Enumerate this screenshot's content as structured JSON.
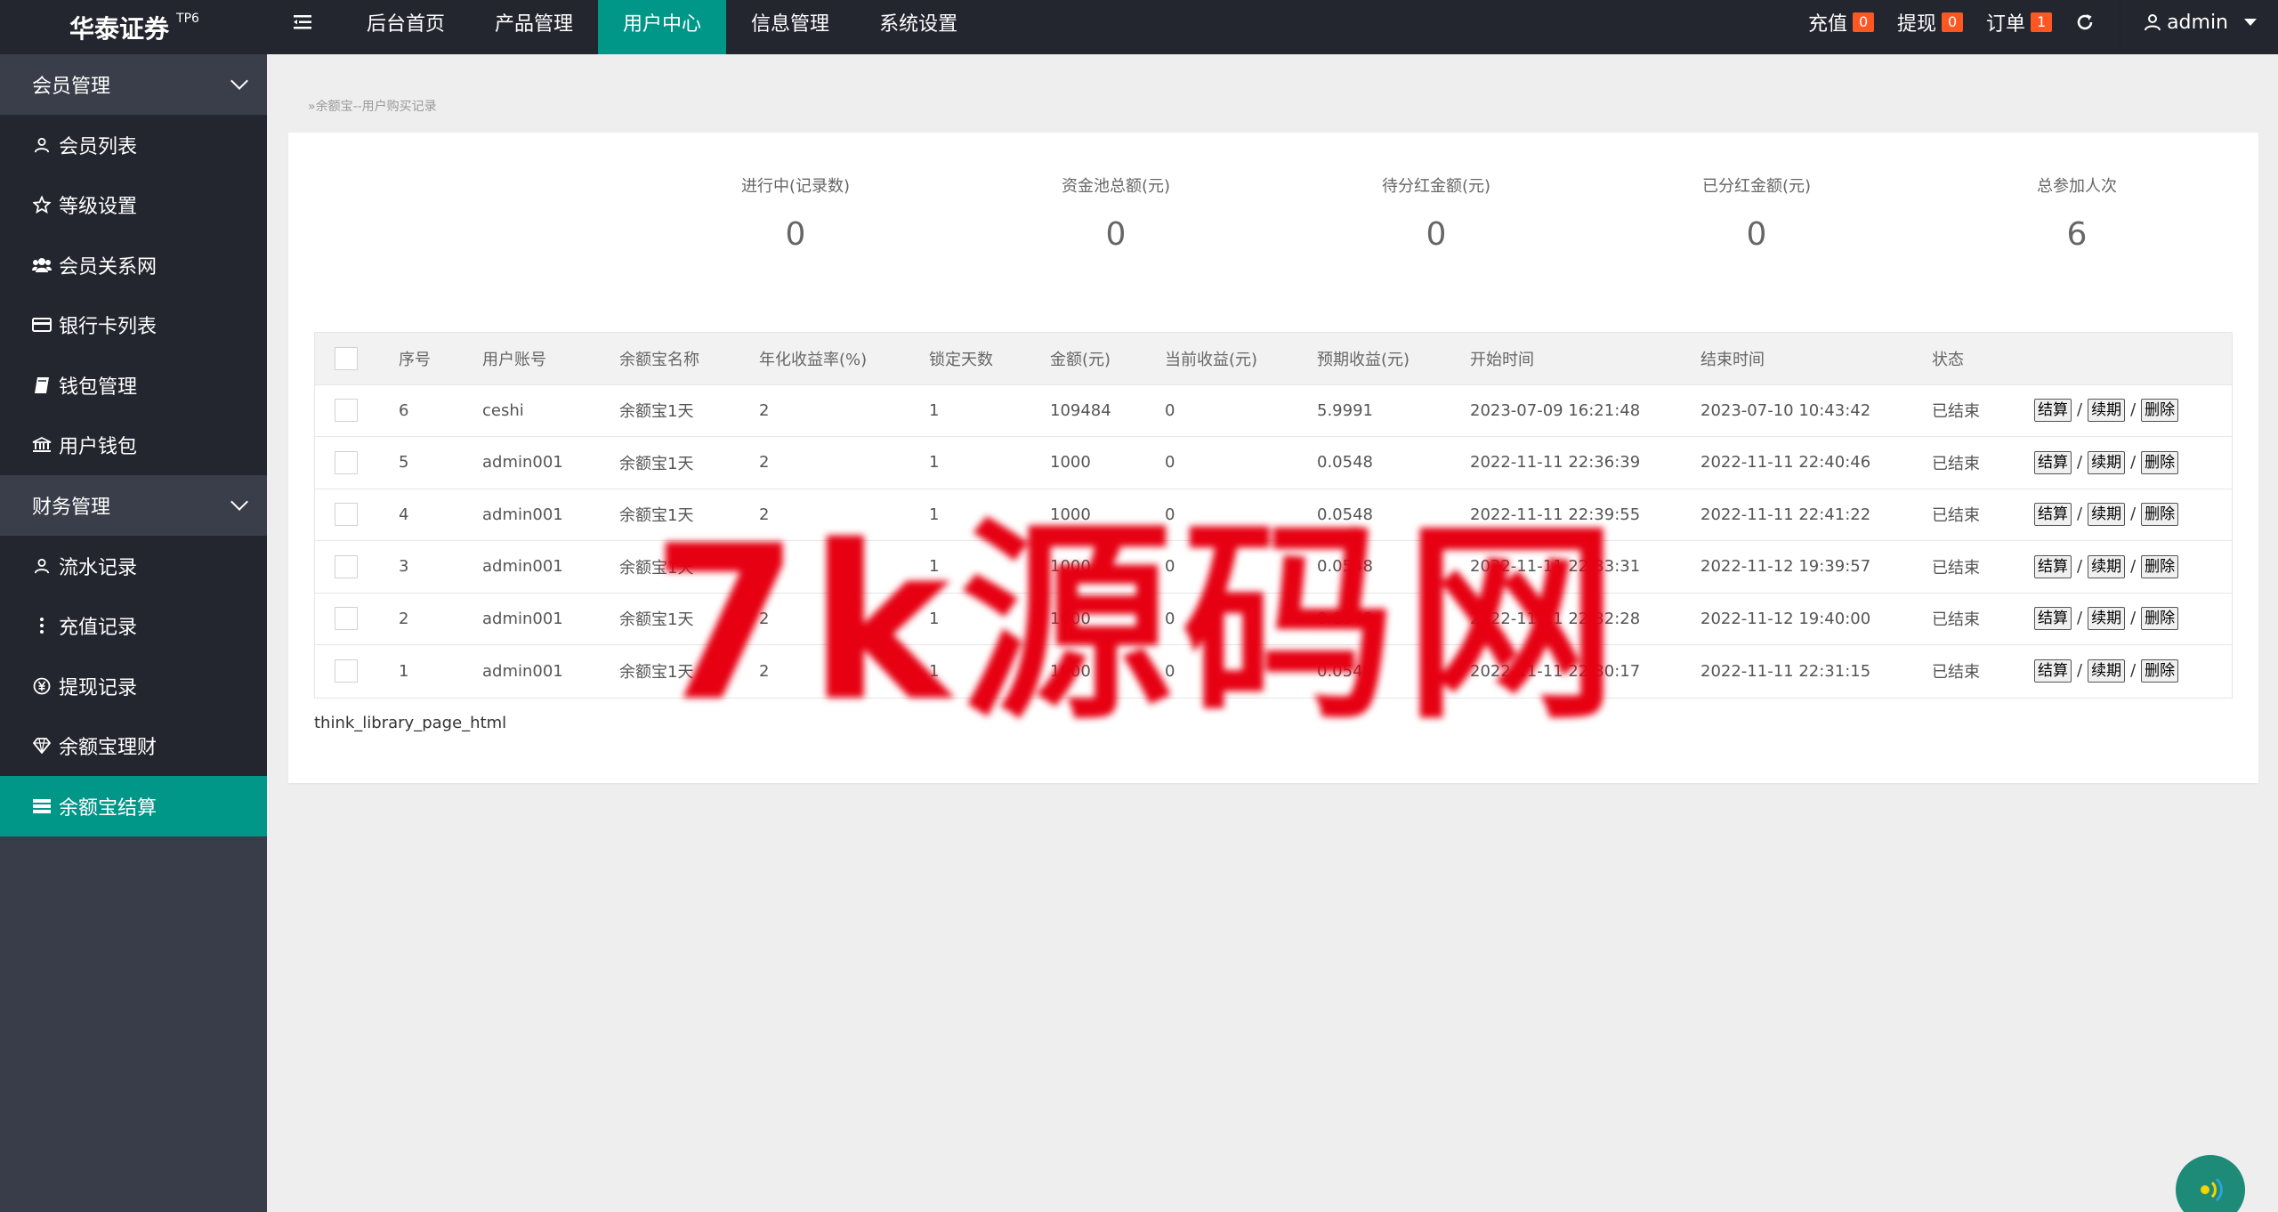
{
  "header": {
    "logo_text": "华泰证券",
    "logo_sup": "TP6",
    "nav": [
      {
        "label": "后台首页"
      },
      {
        "label": "产品管理"
      },
      {
        "label": "用户中心"
      },
      {
        "label": "信息管理"
      },
      {
        "label": "系统设置"
      }
    ],
    "active_nav": "用户中心",
    "recharge_label": "充值",
    "recharge_count": "0",
    "withdraw_label": "提现",
    "withdraw_count": "0",
    "order_label": "订单",
    "order_count": "1",
    "user_name": "admin"
  },
  "sidebar": {
    "groups": [
      {
        "label": "会员管理"
      },
      {
        "label": "财务管理"
      }
    ],
    "member_items": [
      {
        "label": "会员列表",
        "icon": "user-icon"
      },
      {
        "label": "等级设置",
        "icon": "star-icon"
      },
      {
        "label": "会员关系网",
        "icon": "users-icon"
      },
      {
        "label": "银行卡列表",
        "icon": "credit-card-icon"
      },
      {
        "label": "钱包管理",
        "icon": "book-icon"
      },
      {
        "label": "用户钱包",
        "icon": "bank-icon"
      }
    ],
    "finance_items": [
      {
        "label": "流水记录",
        "icon": "user-icon"
      },
      {
        "label": "充值记录",
        "icon": "dots-vertical-icon"
      },
      {
        "label": "提现记录",
        "icon": "yen-icon"
      },
      {
        "label": "余额宝理财",
        "icon": "diamond-icon"
      },
      {
        "label": "余额宝结算",
        "icon": "list-icon"
      }
    ],
    "active_item": "余额宝结算"
  },
  "breadcrumb": "余额宝--用户购买记录",
  "stats": [
    {
      "label": "进行中(记录数)",
      "value": "0"
    },
    {
      "label": "资金池总额(元)",
      "value": "0"
    },
    {
      "label": "待分红金额(元)",
      "value": "0"
    },
    {
      "label": "已分红金额(元)",
      "value": "0"
    },
    {
      "label": "总参加人次",
      "value": "6"
    }
  ],
  "table": {
    "headers": [
      "序号",
      "用户账号",
      "余额宝名称",
      "年化收益率(%)",
      "锁定天数",
      "金额(元)",
      "当前收益(元)",
      "预期收益(元)",
      "开始时间",
      "结束时间",
      "状态"
    ],
    "rows": [
      {
        "id": "6",
        "account": "ceshi",
        "name": "余额宝1天",
        "rate": "2",
        "days": "1",
        "amount": "109484",
        "current": "0",
        "expected": "5.9991",
        "start": "2023-07-09 16:21:48",
        "end": "2023-07-10 10:43:42",
        "status": "已结束"
      },
      {
        "id": "5",
        "account": "admin001",
        "name": "余额宝1天",
        "rate": "2",
        "days": "1",
        "amount": "1000",
        "current": "0",
        "expected": "0.0548",
        "start": "2022-11-11 22:36:39",
        "end": "2022-11-11 22:40:46",
        "status": "已结束"
      },
      {
        "id": "4",
        "account": "admin001",
        "name": "余额宝1天",
        "rate": "2",
        "days": "1",
        "amount": "1000",
        "current": "0",
        "expected": "0.0548",
        "start": "2022-11-11 22:39:55",
        "end": "2022-11-11 22:41:22",
        "status": "已结束"
      },
      {
        "id": "3",
        "account": "admin001",
        "name": "余额宝1天",
        "rate": "2",
        "days": "1",
        "amount": "1000",
        "current": "0",
        "expected": "0.0548",
        "start": "2022-11-11 22:33:31",
        "end": "2022-11-12 19:39:57",
        "status": "已结束"
      },
      {
        "id": "2",
        "account": "admin001",
        "name": "余额宝1天",
        "rate": "2",
        "days": "1",
        "amount": "1000",
        "current": "0",
        "expected": "0.0548",
        "start": "2022-11-11 22:32:28",
        "end": "2022-11-12 19:40:00",
        "status": "已结束"
      },
      {
        "id": "1",
        "account": "admin001",
        "name": "余额宝1天",
        "rate": "2",
        "days": "1",
        "amount": "1000",
        "current": "0",
        "expected": "0.0548",
        "start": "2022-11-11 22:30:17",
        "end": "2022-11-11 22:31:15",
        "status": "已结束"
      }
    ],
    "actions": {
      "settle": "结算",
      "renew": "续期",
      "delete": "删除",
      "sep": "/"
    }
  },
  "pager_text": "think_library_page_html",
  "watermark": "7k源码网",
  "colors": {
    "header_bg": "#23262e",
    "sidebar_bg": "#393d49",
    "accent": "#009688",
    "badge": "#ff5722",
    "watermark": "#e60012"
  }
}
